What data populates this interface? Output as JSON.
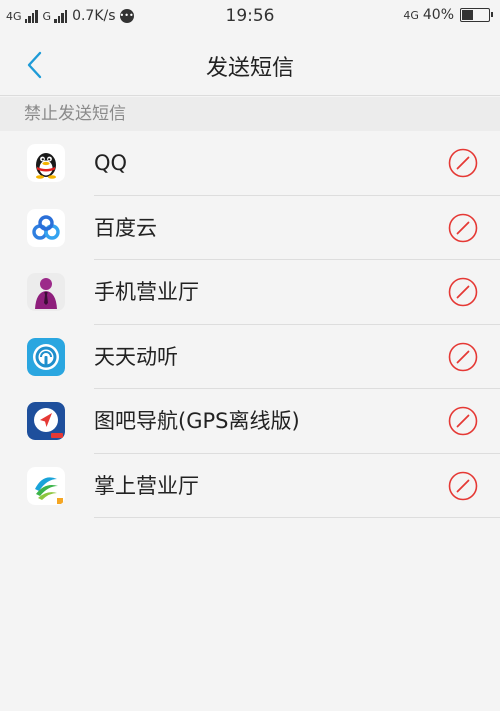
{
  "status_bar": {
    "net_left_1": "4G",
    "net_left_2": "G",
    "speed": "0.7K/s",
    "time": "19:56",
    "net_right": "4G",
    "battery_percent": "40%",
    "battery_level": 0.4
  },
  "header": {
    "title": "发送短信"
  },
  "section": {
    "label": "禁止发送短信"
  },
  "apps": [
    {
      "name": "QQ",
      "icon": "qq-icon"
    },
    {
      "name": "百度云",
      "icon": "baidu-cloud-icon"
    },
    {
      "name": "手机营业厅",
      "icon": "mobile-hall-icon"
    },
    {
      "name": "天天动听",
      "icon": "ttpod-icon"
    },
    {
      "name": "图吧导航(GPS离线版)",
      "icon": "mapbar-navigation-icon"
    },
    {
      "name": "掌上营业厅",
      "icon": "china-mobile-hall-icon"
    }
  ],
  "colors": {
    "accent": "#1e9bd7",
    "block_red": "#e53935"
  }
}
